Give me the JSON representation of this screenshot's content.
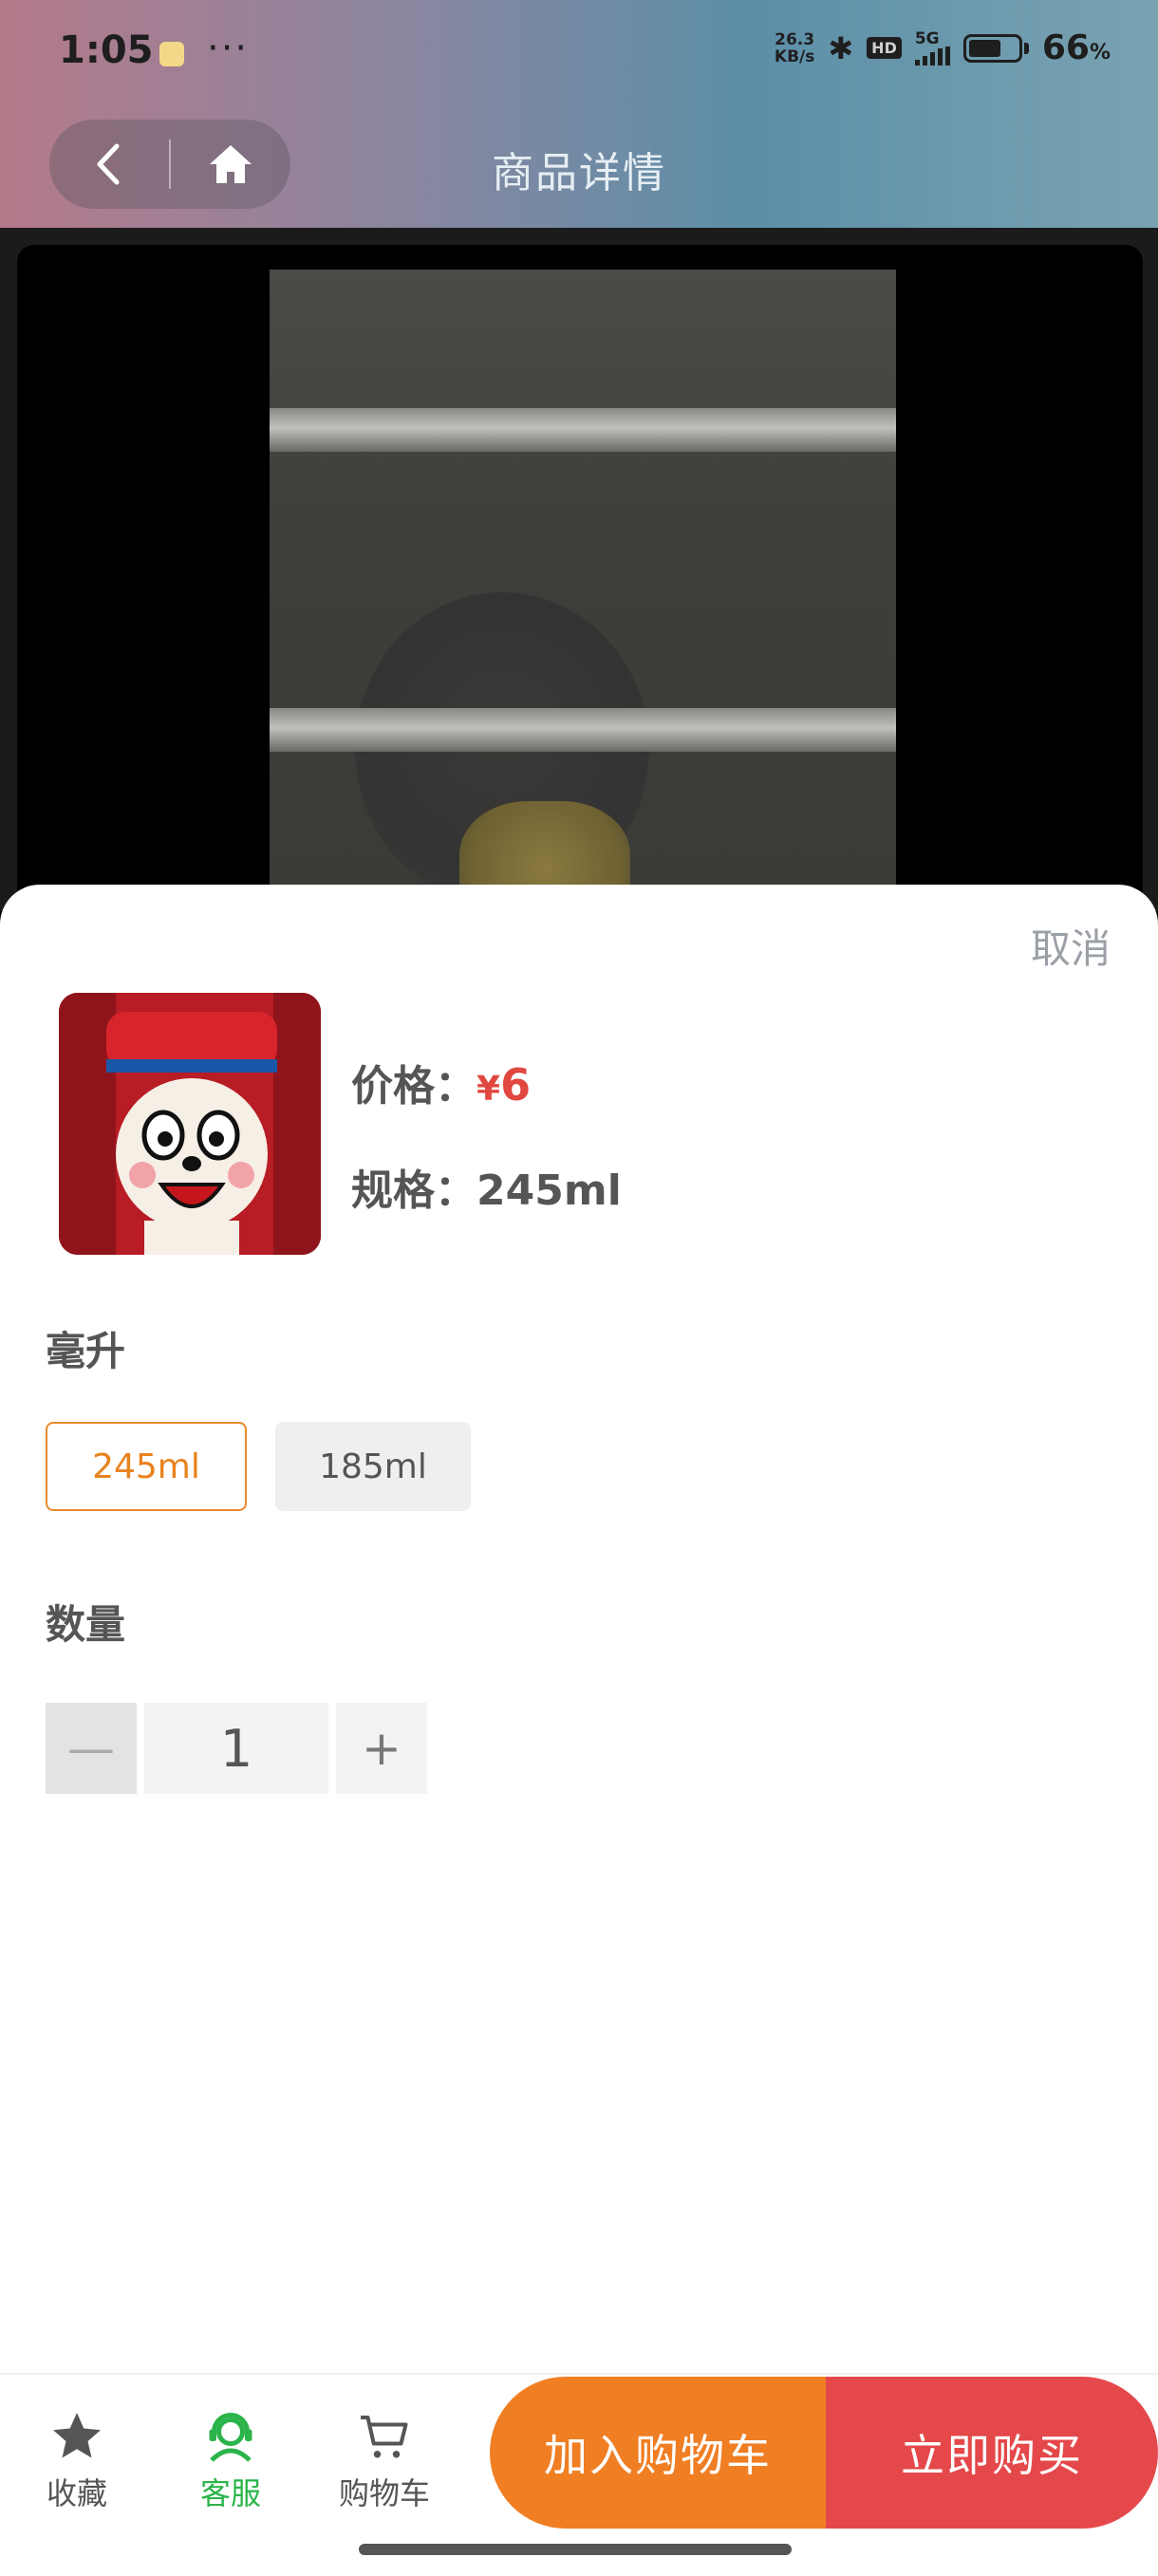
{
  "status": {
    "time": "1:05",
    "dots": "···",
    "net_speed_value": "26.3",
    "net_speed_unit": "KB/s",
    "hd": "HD",
    "network": "5G",
    "battery_percent": "66",
    "battery_level": 0.66
  },
  "header": {
    "title": "商品详情"
  },
  "sheet": {
    "cancel_label": "取消",
    "price_label": "价格：",
    "price_currency": "¥",
    "price_value": "6",
    "spec_label": "规格：",
    "spec_value": "245ml",
    "volume_section_label": "毫升",
    "options": [
      "245ml",
      "185ml"
    ],
    "selected_option": "245ml",
    "quantity_label": "数量",
    "quantity_value": "1",
    "minus_symbol": "—",
    "plus_symbol": "+"
  },
  "bottom_bar": {
    "tabs": [
      {
        "label": "收藏",
        "icon": "star-icon"
      },
      {
        "label": "客服",
        "icon": "customer-service-icon"
      },
      {
        "label": "购物车",
        "icon": "cart-icon"
      }
    ],
    "add_to_cart_label": "加入购物车",
    "buy_now_label": "立即购买"
  },
  "colors": {
    "accent_orange": "#f07e23",
    "accent_red": "#e5484a",
    "price_red": "#e0473f",
    "active_green": "#2bb44a"
  }
}
